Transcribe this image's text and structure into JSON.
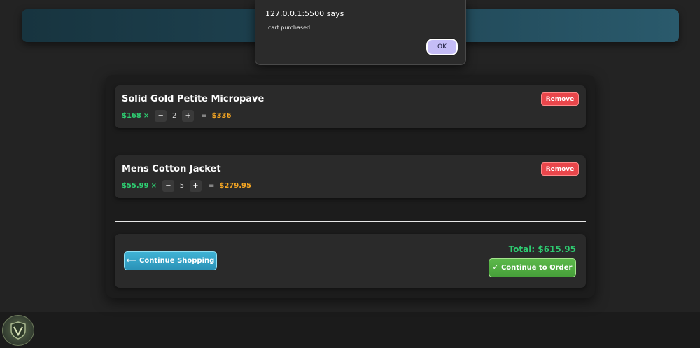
{
  "dialog": {
    "title": "127.0.0.1:5500 says",
    "message": "cart purchased",
    "ok_label": "OK"
  },
  "cart": {
    "items": [
      {
        "name": "Solid Gold Petite Micropave",
        "price": "$168",
        "times": "×",
        "minus": "−",
        "quantity": "2",
        "plus": "+",
        "equals": "=",
        "subtotal": "$336",
        "remove_label": "Remove"
      },
      {
        "name": "Mens Cotton Jacket",
        "price": "$55.99",
        "times": "×",
        "minus": "−",
        "quantity": "5",
        "plus": "+",
        "equals": "=",
        "subtotal": "$279.95",
        "remove_label": "Remove"
      }
    ],
    "summary": {
      "continue_shopping_label": "Continue Shopping",
      "continue_shopping_icon": "⟵",
      "total": "Total: $615.95",
      "continue_order_label": "Continue to Order",
      "continue_order_icon": "✓"
    }
  },
  "colors": {
    "price_green": "#2ecc71",
    "subtotal_orange": "#f5a623",
    "remove_red": "#e9464b",
    "shopping_blue": "#2b93b8",
    "order_green": "#47a03a"
  },
  "icons": {
    "arrow": "arrow-left-icon",
    "check": "check-icon",
    "corner_logo": "shield-logo-icon"
  }
}
